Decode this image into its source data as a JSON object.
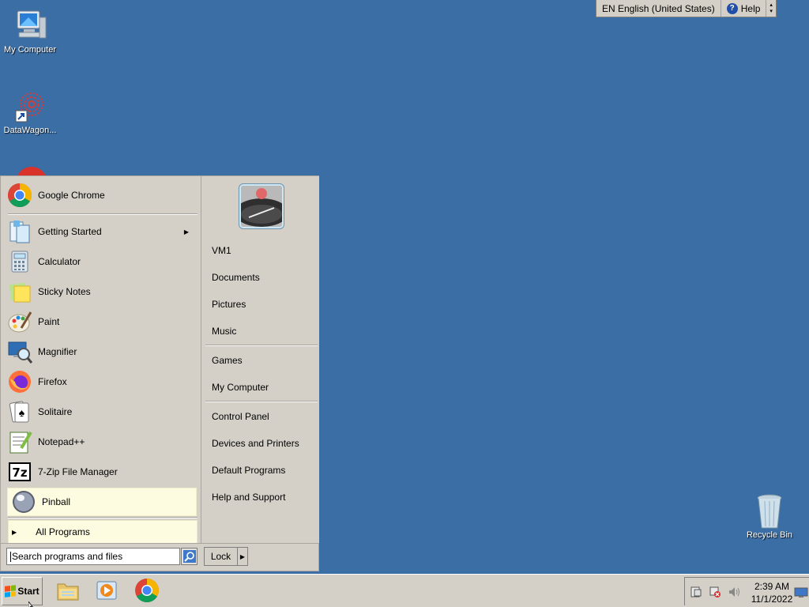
{
  "language_bar": {
    "language": "EN English (United States)",
    "help": "Help"
  },
  "desktop": {
    "icons": [
      {
        "label": "My Computer"
      },
      {
        "label": "DataWagon..."
      },
      {
        "label": "Recycle Bin"
      }
    ]
  },
  "start_menu": {
    "pinned": {
      "label": "Google Chrome",
      "icon": "chrome-icon"
    },
    "recent": [
      {
        "label": "Getting Started",
        "icon": "getting-started-icon",
        "submenu": true
      },
      {
        "label": "Calculator",
        "icon": "calculator-icon"
      },
      {
        "label": "Sticky Notes",
        "icon": "sticky-notes-icon"
      },
      {
        "label": "Paint",
        "icon": "paint-icon"
      },
      {
        "label": "Magnifier",
        "icon": "magnifier-icon"
      },
      {
        "label": "Firefox",
        "icon": "firefox-icon"
      },
      {
        "label": "Solitaire",
        "icon": "solitaire-icon"
      },
      {
        "label": "Notepad++",
        "icon": "notepadpp-icon"
      },
      {
        "label": "7-Zip File Manager",
        "icon": "7zip-icon"
      },
      {
        "label": "Pinball",
        "icon": "pinball-icon",
        "highlighted": true
      }
    ],
    "all_programs": "All Programs",
    "search": {
      "placeholder": "Search programs and files"
    },
    "lock": "Lock",
    "right_items": [
      {
        "label": "VM1"
      },
      {
        "label": "Documents"
      },
      {
        "label": "Pictures"
      },
      {
        "label": "Music"
      },
      {
        "label": "Games"
      },
      {
        "label": "My Computer"
      },
      {
        "label": "Control Panel"
      },
      {
        "label": "Devices and Printers"
      },
      {
        "label": "Default Programs"
      },
      {
        "label": "Help and Support"
      }
    ]
  },
  "taskbar": {
    "start": "Start",
    "pinned": [
      "file-explorer-icon",
      "media-player-icon",
      "chrome-icon"
    ],
    "clock": {
      "time": "2:39 AM",
      "date": "11/1/2022"
    }
  }
}
